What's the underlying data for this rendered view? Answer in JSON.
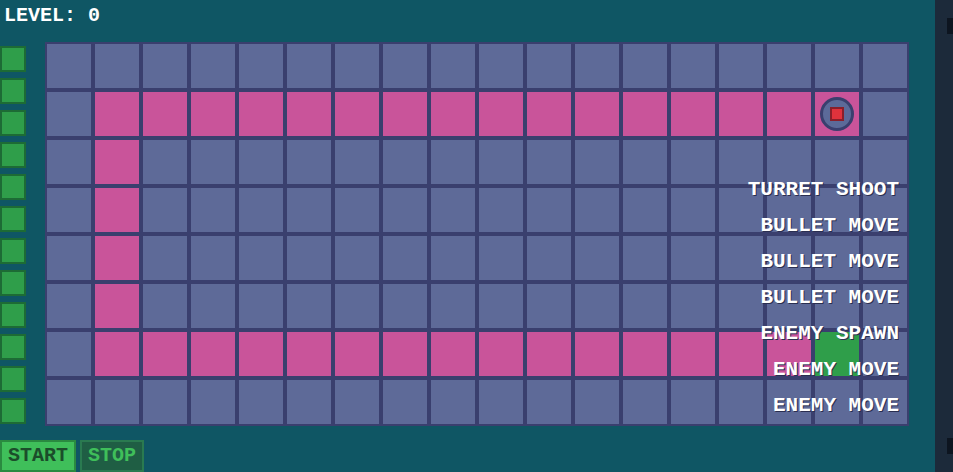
{
  "header": {
    "level_label": "LEVEL: 0"
  },
  "queue_slots": [
    {
      "filled": true
    },
    {
      "filled": true
    },
    {
      "filled": true
    },
    {
      "filled": true
    },
    {
      "filled": true
    },
    {
      "filled": true
    },
    {
      "filled": true
    },
    {
      "filled": true
    },
    {
      "filled": true
    },
    {
      "filled": true
    },
    {
      "filled": true
    },
    {
      "filled": true
    }
  ],
  "board": {
    "rows": [
      [
        "empty",
        "empty",
        "empty",
        "empty",
        "empty",
        "empty",
        "empty",
        "empty",
        "empty",
        "empty",
        "empty",
        "empty",
        "empty",
        "empty",
        "empty",
        "empty",
        "empty",
        "empty"
      ],
      [
        "empty",
        "path",
        "path",
        "path",
        "path",
        "path",
        "path",
        "path",
        "path",
        "path",
        "path",
        "path",
        "path",
        "path",
        "path",
        "path",
        "turret",
        "empty"
      ],
      [
        "empty",
        "path",
        "empty",
        "empty",
        "empty",
        "empty",
        "empty",
        "empty",
        "empty",
        "empty",
        "empty",
        "empty",
        "empty",
        "empty",
        "empty",
        "empty",
        "empty",
        "empty"
      ],
      [
        "empty",
        "path",
        "empty",
        "empty",
        "empty",
        "empty",
        "empty",
        "empty",
        "empty",
        "empty",
        "empty",
        "empty",
        "empty",
        "empty",
        "empty",
        "empty",
        "empty",
        "empty"
      ],
      [
        "empty",
        "path",
        "empty",
        "empty",
        "empty",
        "empty",
        "empty",
        "empty",
        "empty",
        "empty",
        "empty",
        "empty",
        "empty",
        "empty",
        "empty",
        "empty",
        "empty",
        "empty"
      ],
      [
        "empty",
        "path",
        "empty",
        "empty",
        "empty",
        "empty",
        "empty",
        "empty",
        "empty",
        "empty",
        "empty",
        "empty",
        "empty",
        "empty",
        "empty",
        "empty",
        "empty",
        "empty"
      ],
      [
        "empty",
        "path",
        "path",
        "path",
        "path",
        "path",
        "path",
        "path",
        "path",
        "path",
        "path",
        "path",
        "path",
        "path",
        "path",
        "path",
        "enemy",
        "empty"
      ],
      [
        "empty",
        "empty",
        "empty",
        "empty",
        "empty",
        "empty",
        "empty",
        "empty",
        "empty",
        "empty",
        "empty",
        "empty",
        "empty",
        "empty",
        "empty",
        "empty",
        "empty",
        "empty"
      ]
    ]
  },
  "actions": [
    "TURRET SHOOT",
    "BULLET MOVE",
    "BULLET MOVE",
    "BULLET MOVE",
    "ENEMY SPAWN",
    "ENEMY MOVE",
    "ENEMY MOVE"
  ],
  "buttons": [
    {
      "label": "START",
      "selected": true
    },
    {
      "label": "STOP",
      "selected": false
    }
  ]
}
